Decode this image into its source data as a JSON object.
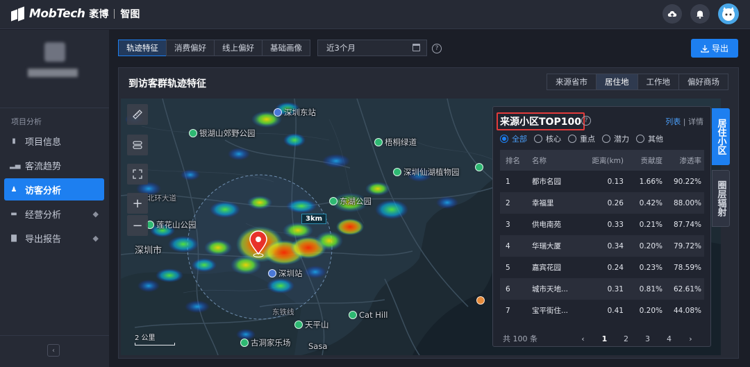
{
  "header": {
    "brand": "MobTech",
    "brand_cn": "袤博",
    "product": "智图"
  },
  "sidebar": {
    "section": "项目分析",
    "items": [
      {
        "label": "项目信息",
        "icon": "file-icon"
      },
      {
        "label": "客流趋势",
        "icon": "bar-chart-icon"
      },
      {
        "label": "访客分析",
        "icon": "user-icon",
        "active": true
      },
      {
        "label": "经营分析",
        "icon": "folder-icon",
        "premium": true
      },
      {
        "label": "导出报告",
        "icon": "report-icon",
        "premium": true
      }
    ],
    "collapse": "‹"
  },
  "toolbar": {
    "tabs": [
      "轨迹特征",
      "消费偏好",
      "线上偏好",
      "基础画像"
    ],
    "active_tab": "轨迹特征",
    "date_range": "近3个月",
    "export_label": "导出"
  },
  "panel": {
    "title": "到访客群轨迹特征",
    "tabs": [
      "来源省市",
      "居住地",
      "工作地",
      "偏好商场"
    ],
    "active_tab": "居住地"
  },
  "map": {
    "labels": {
      "shenzhen_east": "深圳东站",
      "yinhu": "银湖山郊野公园",
      "wutong": "梧桐绿道",
      "botanical": "深圳仙湖植物园",
      "beihuan": "北环大道",
      "dongshan": "东湖公园",
      "lianhua": "莲花山公园",
      "shenzhen_city": "深圳市",
      "shenzhen_station": "深圳站",
      "dongtie": "东铁线",
      "catihill": "Cat Hill",
      "tianping": "天平山",
      "sasa": "Sasa",
      "guhe": "古洞家乐场"
    },
    "distance_badge": "3km",
    "scale_label": "2 公里",
    "controls": [
      "ruler",
      "layers",
      "fullscreen",
      "zoom-in",
      "zoom-out"
    ]
  },
  "card": {
    "title": "来源小区TOP100",
    "link_list": "列表",
    "link_detail": "详情",
    "filters": [
      "全部",
      "核心",
      "重点",
      "潜力",
      "其他"
    ],
    "active_filter": "全部",
    "columns": [
      "排名",
      "名称",
      "距离(km)",
      "贡献度",
      "渗透率"
    ],
    "rows": [
      {
        "rank": "1",
        "name": "都市名园",
        "dist": "0.13",
        "contrib": "1.66%",
        "pen": "90.22%"
      },
      {
        "rank": "2",
        "name": "幸福里",
        "dist": "0.26",
        "contrib": "0.42%",
        "pen": "88.00%"
      },
      {
        "rank": "3",
        "name": "供电南苑",
        "dist": "0.33",
        "contrib": "0.21%",
        "pen": "87.74%"
      },
      {
        "rank": "4",
        "name": "华瑞大厦",
        "dist": "0.34",
        "contrib": "0.20%",
        "pen": "79.72%"
      },
      {
        "rank": "5",
        "name": "嘉宾花园",
        "dist": "0.24",
        "contrib": "0.23%",
        "pen": "78.59%"
      },
      {
        "rank": "6",
        "name": "城市天地...",
        "dist": "0.31",
        "contrib": "0.81%",
        "pen": "62.61%"
      },
      {
        "rank": "7",
        "name": "宝平街住...",
        "dist": "0.41",
        "contrib": "0.20%",
        "pen": "44.08%"
      }
    ],
    "total": "共 100 条",
    "pages": [
      "1",
      "2",
      "3",
      "4"
    ],
    "current_page": "1"
  },
  "side_tabs": {
    "residential": "居住小区",
    "radiation": "圈层辐射"
  }
}
